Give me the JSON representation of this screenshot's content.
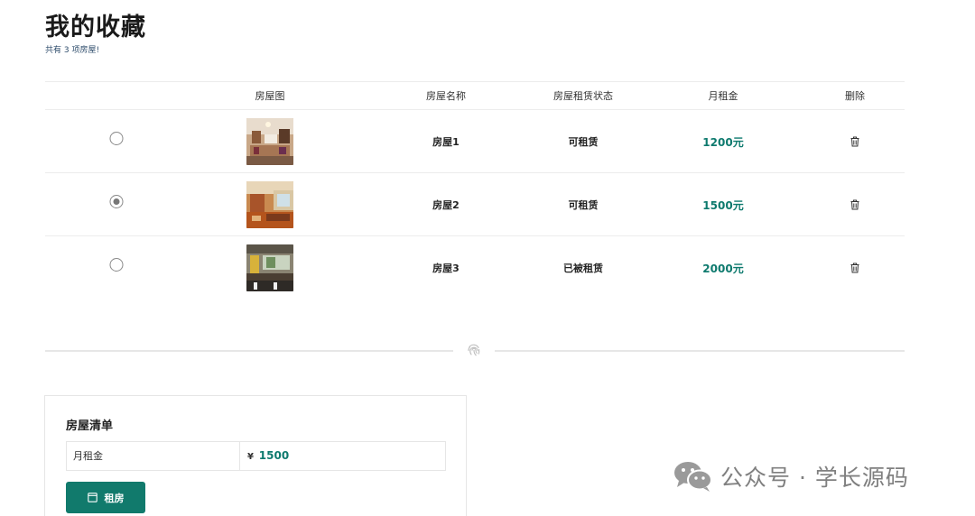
{
  "page": {
    "title": "我的收藏",
    "subtitle": "共有 3 项房屋!"
  },
  "table": {
    "columns": [
      "",
      "房屋图",
      "房屋名称",
      "房屋租赁状态",
      "月租金",
      "删除"
    ],
    "rows": [
      {
        "selected": false,
        "name": "房屋1",
        "status": "可租赁",
        "rent": "1200元"
      },
      {
        "selected": true,
        "name": "房屋2",
        "status": "可租赁",
        "rent": "1500元"
      },
      {
        "selected": false,
        "name": "房屋3",
        "status": "已被租赁",
        "rent": "2000元"
      }
    ]
  },
  "panel": {
    "title": "房屋清单",
    "rent_label": "月租金",
    "currency": "¥",
    "rent_value": "1500",
    "button_label": "租房"
  },
  "watermark": {
    "text": "公众号 · 学长源码"
  },
  "colors": {
    "accent": "#117a6c",
    "rent_text": "#0e7a6e"
  },
  "icons": {
    "radio": "radio-button",
    "delete": "trash-icon",
    "divider": "fingerprint-icon",
    "button": "window-icon",
    "watermark": "wechat-icon"
  }
}
